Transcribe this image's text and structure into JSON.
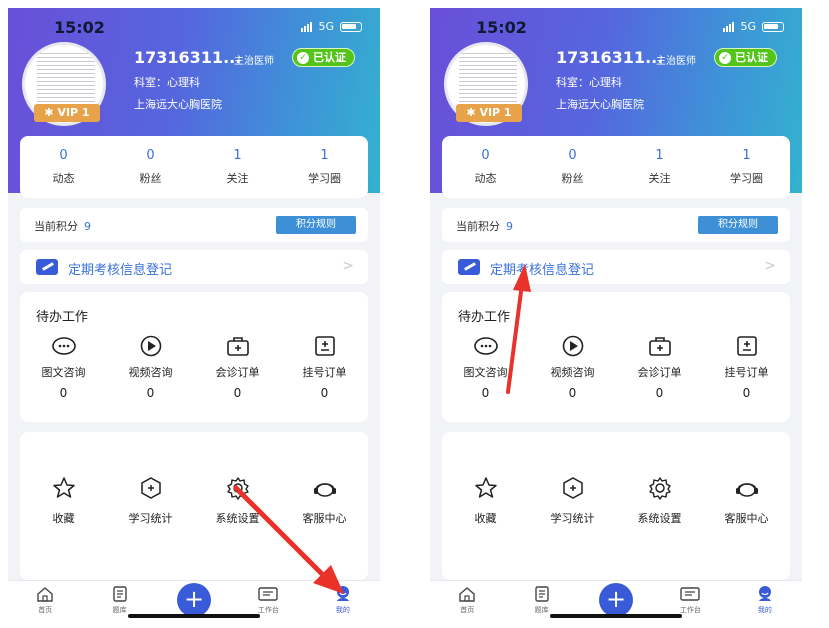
{
  "colors": {
    "accent": "#3a72d8",
    "arrow": "#e8322a",
    "verified": "#52c41a",
    "vip": "#e8a24a"
  },
  "screens": [
    {
      "status": {
        "time": "15:02",
        "network": "5G"
      },
      "profile": {
        "phone": "17316311...",
        "title": "主治医师",
        "verified": "已认证",
        "dept": "科室：心理科",
        "hospital": "上海远大心胸医院",
        "vip": "VIP 1"
      },
      "stats": [
        {
          "value": "0",
          "label": "动态"
        },
        {
          "value": "0",
          "label": "粉丝"
        },
        {
          "value": "1",
          "label": "关注"
        },
        {
          "value": "1",
          "label": "学习圈"
        }
      ],
      "points": {
        "label": "当前积分",
        "value": "9",
        "rule_button": "积分规则"
      },
      "register": {
        "label": "定期考核信息登记",
        "chevron": ">"
      },
      "todo": {
        "title": "待办工作",
        "items": [
          {
            "icon": "chat-bubble-icon",
            "label": "图文咨询",
            "count": "0"
          },
          {
            "icon": "video-play-icon",
            "label": "视频咨询",
            "count": "0"
          },
          {
            "icon": "medical-kit-icon",
            "label": "会诊订单",
            "count": "0"
          },
          {
            "icon": "register-form-icon",
            "label": "挂号订单",
            "count": "0"
          }
        ]
      },
      "tools": [
        {
          "icon": "star-icon",
          "label": "收藏"
        },
        {
          "icon": "study-stats-icon",
          "label": "学习统计"
        },
        {
          "icon": "gear-icon",
          "label": "系统设置"
        },
        {
          "icon": "headset-icon",
          "label": "客服中心"
        }
      ],
      "tabs": [
        {
          "icon": "home-icon",
          "label": "首页"
        },
        {
          "icon": "question-bank-icon",
          "label": "题库"
        },
        {
          "icon": "plus-icon",
          "label": "+"
        },
        {
          "icon": "workbench-icon",
          "label": "工作台"
        },
        {
          "icon": "my-profile-icon",
          "label": "我的"
        }
      ]
    },
    {
      "status": {
        "time": "15:02",
        "network": "5G"
      },
      "profile": {
        "phone": "17316311...",
        "title": "主治医师",
        "verified": "已认证",
        "dept": "科室：心理科",
        "hospital": "上海远大心胸医院",
        "vip": "VIP 1"
      },
      "stats": [
        {
          "value": "0",
          "label": "动态"
        },
        {
          "value": "0",
          "label": "粉丝"
        },
        {
          "value": "1",
          "label": "关注"
        },
        {
          "value": "1",
          "label": "学习圈"
        }
      ],
      "points": {
        "label": "当前积分",
        "value": "9",
        "rule_button": "积分规则"
      },
      "register": {
        "label": "定期考核信息登记",
        "chevron": ">"
      },
      "todo": {
        "title": "待办工作",
        "items": [
          {
            "icon": "chat-bubble-icon",
            "label": "图文咨询",
            "count": "0"
          },
          {
            "icon": "video-play-icon",
            "label": "视频咨询",
            "count": "0"
          },
          {
            "icon": "medical-kit-icon",
            "label": "会诊订单",
            "count": "0"
          },
          {
            "icon": "register-form-icon",
            "label": "挂号订单",
            "count": "0"
          }
        ]
      },
      "tools": [
        {
          "icon": "star-icon",
          "label": "收藏"
        },
        {
          "icon": "study-stats-icon",
          "label": "学习统计"
        },
        {
          "icon": "gear-icon",
          "label": "系统设置"
        },
        {
          "icon": "headset-icon",
          "label": "客服中心"
        }
      ],
      "tabs": [
        {
          "icon": "home-icon",
          "label": "首页"
        },
        {
          "icon": "question-bank-icon",
          "label": "题库"
        },
        {
          "icon": "plus-icon",
          "label": "+"
        },
        {
          "icon": "workbench-icon",
          "label": "工作台"
        },
        {
          "icon": "my-profile-icon",
          "label": "我的"
        }
      ]
    }
  ]
}
